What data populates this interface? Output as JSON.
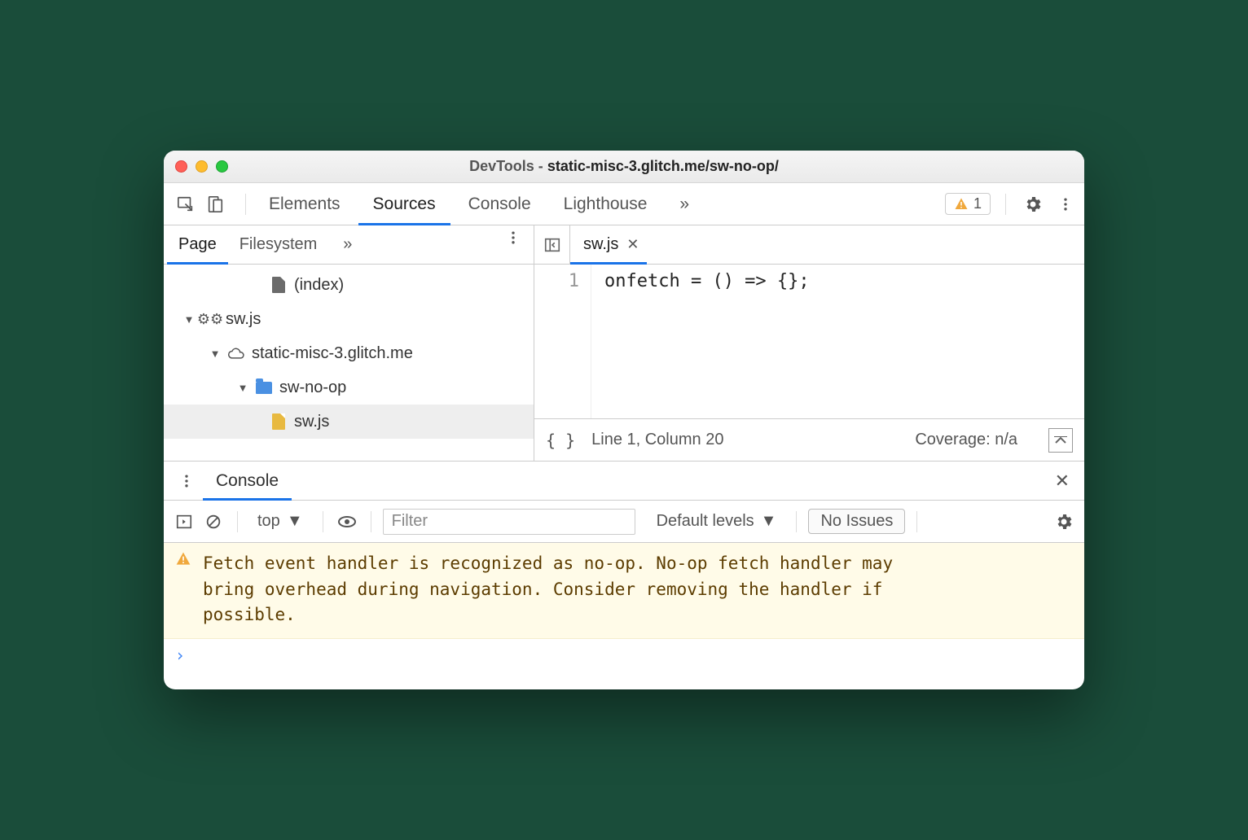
{
  "window": {
    "title_prefix": "DevTools - ",
    "title_main": "static-misc-3.glitch.me/sw-no-op/"
  },
  "toolbar": {
    "tabs": [
      "Elements",
      "Sources",
      "Console",
      "Lighthouse"
    ],
    "active_tab": "Sources",
    "warning_count": "1"
  },
  "sources": {
    "subtabs": [
      "Page",
      "Filesystem"
    ],
    "active_subtab": "Page",
    "tree": {
      "index_label": "(index)",
      "sw_root": "sw.js",
      "domain": "static-misc-3.glitch.me",
      "folder": "sw-no-op",
      "file": "sw.js"
    }
  },
  "editor": {
    "open_file": "sw.js",
    "line_numbers": [
      "1"
    ],
    "code": "onfetch = () => {};"
  },
  "statusbar": {
    "braces": "{ }",
    "position": "Line 1, Column 20",
    "coverage": "Coverage: n/a"
  },
  "drawer": {
    "tab": "Console"
  },
  "console": {
    "scope": "top",
    "filter_placeholder": "Filter",
    "levels": "Default levels",
    "issues_button": "No Issues",
    "warning_message": "Fetch event handler is recognized as no-op. No-op fetch handler may bring overhead during navigation. Consider removing the handler if possible.",
    "prompt": "›"
  }
}
